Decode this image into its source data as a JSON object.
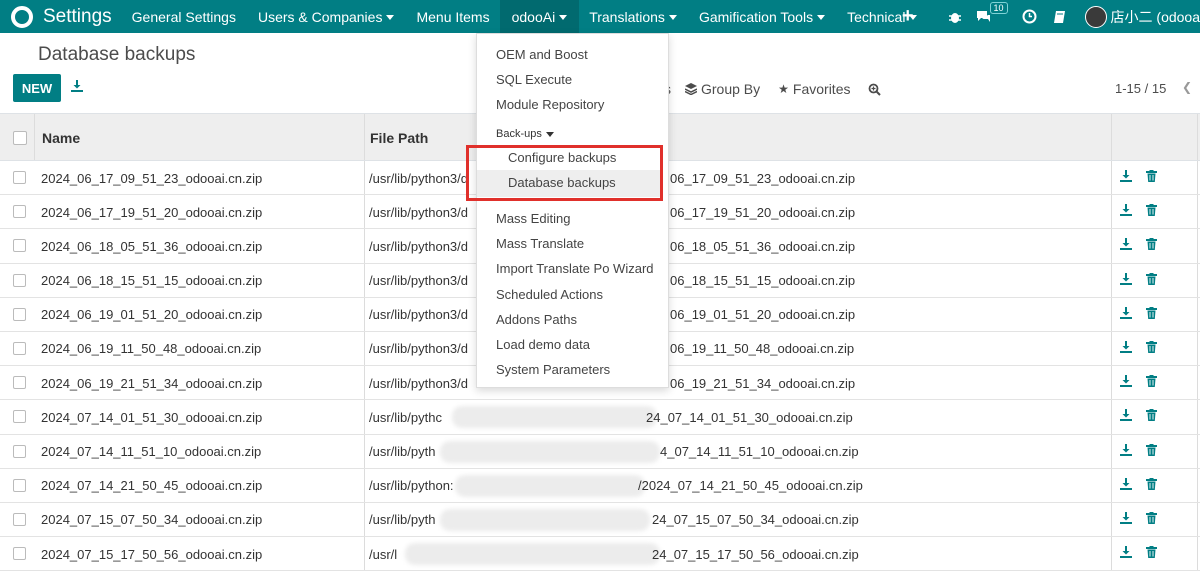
{
  "navbar": {
    "brand": "Settings",
    "items": [
      {
        "label": "General Settings",
        "has_caret": false
      },
      {
        "label": "Users & Companies",
        "has_caret": true
      },
      {
        "label": "Menu Items",
        "has_caret": false
      },
      {
        "label": "odooAi",
        "has_caret": true,
        "active": true
      },
      {
        "label": "Translations",
        "has_caret": true
      },
      {
        "label": "Gamification Tools",
        "has_caret": true
      },
      {
        "label": "Technical",
        "has_caret": true
      }
    ],
    "plus_icon": "+",
    "message_count": "10",
    "user_name": "店小二 (odooa"
  },
  "control_panel": {
    "title": "Database backups",
    "new_button": "NEW",
    "filters_fragment": "s",
    "group_by": "Group By",
    "favorites": "Favorites",
    "pager": "1-15 / 15"
  },
  "table": {
    "headers": {
      "name": "Name",
      "file_path": "File Path"
    },
    "rows": [
      {
        "name": "2024_06_17_09_51_23_odooai.cn.zip",
        "path_start": "/usr/lib/python3/d",
        "path_end": "06_17_09_51_23_odooai.cn.zip"
      },
      {
        "name": "2024_06_17_19_51_20_odooai.cn.zip",
        "path_start": "/usr/lib/python3/d",
        "path_end": "06_17_19_51_20_odooai.cn.zip"
      },
      {
        "name": "2024_06_18_05_51_36_odooai.cn.zip",
        "path_start": "/usr/lib/python3/d",
        "path_end": "06_18_05_51_36_odooai.cn.zip"
      },
      {
        "name": "2024_06_18_15_51_15_odooai.cn.zip",
        "path_start": "/usr/lib/python3/d",
        "path_end": "06_18_15_51_15_odooai.cn.zip"
      },
      {
        "name": "2024_06_19_01_51_20_odooai.cn.zip",
        "path_start": "/usr/lib/python3/d",
        "path_end": "06_19_01_51_20_odooai.cn.zip"
      },
      {
        "name": "2024_06_19_11_50_48_odooai.cn.zip",
        "path_start": "/usr/lib/python3/d",
        "path_end": "06_19_11_50_48_odooai.cn.zip"
      },
      {
        "name": "2024_06_19_21_51_34_odooai.cn.zip",
        "path_start": "/usr/lib/python3/d",
        "path_end": "06_19_21_51_34_odooai.cn.zip"
      },
      {
        "name": "2024_07_14_01_51_30_odooai.cn.zip",
        "path_start": "/usr/lib/pythc",
        "path_end": "24_07_14_01_51_30_odooai.cn.zip"
      },
      {
        "name": "2024_07_14_11_51_10_odooai.cn.zip",
        "path_start": "/usr/lib/pyth",
        "path_end": "4_07_14_11_51_10_odooai.cn.zip"
      },
      {
        "name": "2024_07_14_21_50_45_odooai.cn.zip",
        "path_start": "/usr/lib/python:",
        "path_end": "/2024_07_14_21_50_45_odooai.cn.zip"
      },
      {
        "name": "2024_07_15_07_50_34_odooai.cn.zip",
        "path_start": "/usr/lib/pyth",
        "path_end": "24_07_15_07_50_34_odooai.cn.zip"
      },
      {
        "name": "2024_07_15_17_50_56_odooai.cn.zip",
        "path_start": "/usr/l",
        "path_end": "24_07_15_17_50_56_odooai.cn.zip"
      }
    ]
  },
  "dropdown": {
    "items_top": [
      "OEM and Boost",
      "SQL Execute",
      "Module Repository"
    ],
    "section_header": "Back-ups",
    "section_items": [
      "Configure backups",
      "Database backups"
    ],
    "items_bottom": [
      "Mass Editing",
      "Mass Translate",
      "Import Translate Po Wizard",
      "Scheduled Actions",
      "Addons Paths",
      "Load demo data",
      "System Parameters"
    ]
  },
  "icons": {
    "download": "download-icon",
    "delete": "trash-icon",
    "search": "magnifier-plus-icon"
  },
  "colors": {
    "brand": "#017e84",
    "highlight": "#e0302b"
  }
}
